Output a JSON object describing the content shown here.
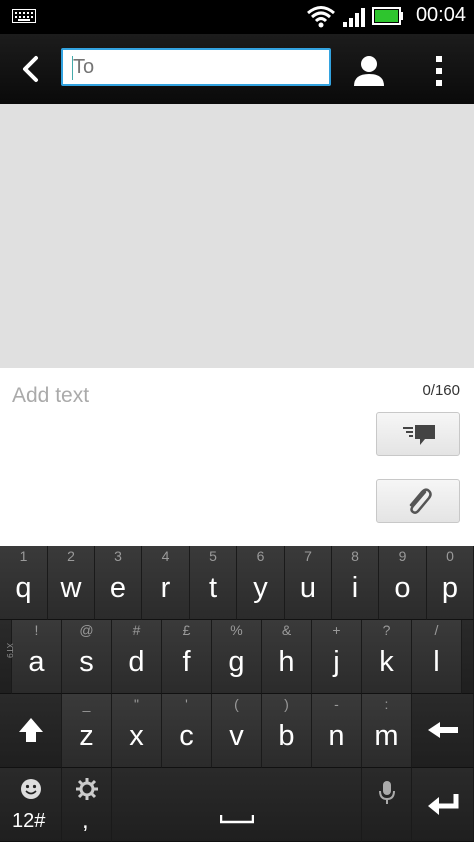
{
  "status_bar": {
    "time": "00:04",
    "icons": [
      "keyboard-icon",
      "wifi-icon",
      "signal-icon",
      "battery-icon"
    ],
    "battery_color": "#2ec52e"
  },
  "action_bar": {
    "to_placeholder": "To",
    "icons": [
      "back-arrow-icon",
      "contact-icon",
      "overflow-menu-icon"
    ],
    "accent": "#33a3e0"
  },
  "compose": {
    "placeholder": "Add text",
    "char_count": "0/160",
    "buttons": [
      "send-icon",
      "paperclip-icon"
    ]
  },
  "keyboard": {
    "row1": [
      {
        "main": "q",
        "sub": "1"
      },
      {
        "main": "w",
        "sub": "2"
      },
      {
        "main": "e",
        "sub": "3"
      },
      {
        "main": "r",
        "sub": "4"
      },
      {
        "main": "t",
        "sub": "5"
      },
      {
        "main": "y",
        "sub": "6"
      },
      {
        "main": "u",
        "sub": "7"
      },
      {
        "main": "i",
        "sub": "8"
      },
      {
        "main": "o",
        "sub": "9"
      },
      {
        "main": "p",
        "sub": "0"
      }
    ],
    "row2": [
      {
        "main": "a",
        "sub": "!"
      },
      {
        "main": "s",
        "sub": "@"
      },
      {
        "main": "d",
        "sub": "#"
      },
      {
        "main": "f",
        "sub": "£"
      },
      {
        "main": "g",
        "sub": "%"
      },
      {
        "main": "h",
        "sub": "&"
      },
      {
        "main": "j",
        "sub": "+"
      },
      {
        "main": "k",
        "sub": "?"
      },
      {
        "main": "l",
        "sub": "/"
      }
    ],
    "row3": [
      {
        "main": "z",
        "sub": "_"
      },
      {
        "main": "x",
        "sub": "\""
      },
      {
        "main": "c",
        "sub": "'"
      },
      {
        "main": "v",
        "sub": "("
      },
      {
        "main": "b",
        "sub": ")"
      },
      {
        "main": "n",
        "sub": "-"
      },
      {
        "main": "m",
        "sub": ":"
      }
    ],
    "xt9": "XT9",
    "symbols_label": "12#",
    "comma": ","
  }
}
